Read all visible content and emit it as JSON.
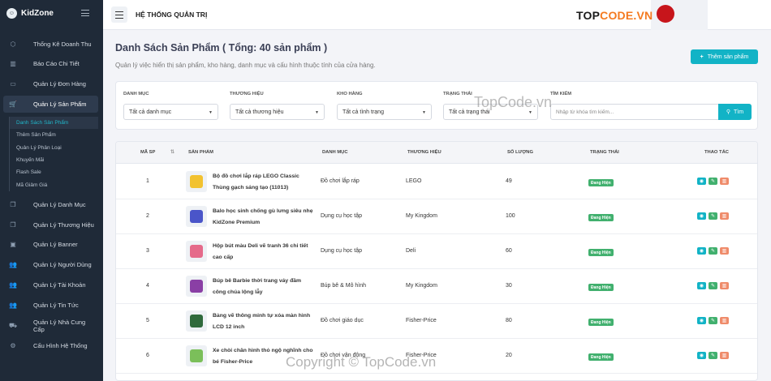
{
  "brand": {
    "name": "KidZone"
  },
  "topbar": {
    "title": "HỆ THỐNG QUẢN TRỊ"
  },
  "watermark": {
    "logo_text_a": "TOP",
    "logo_text_b": "CODE.VN",
    "center": "TopCode.vn",
    "copyright": "Copyright © TopCode.vn"
  },
  "sidebar": {
    "items": [
      {
        "label": "Thống Kê Doanh Thu",
        "icon": "cube-icon"
      },
      {
        "label": "Báo Cáo Chi Tiết",
        "icon": "chart-icon"
      },
      {
        "label": "Quản Lý Đơn Hàng",
        "icon": "card-icon"
      },
      {
        "label": "Quản Lý Sản Phẩm",
        "icon": "cart-icon"
      },
      {
        "label": "Quản Lý Danh Mục",
        "icon": "copy-icon"
      },
      {
        "label": "Quản Lý Thương Hiệu",
        "icon": "copy-icon"
      },
      {
        "label": "Quản Lý Banner",
        "icon": "image-icon"
      },
      {
        "label": "Quản Lý Người Dùng",
        "icon": "users-icon"
      },
      {
        "label": "Quản Lý Tài Khoản",
        "icon": "users-icon"
      },
      {
        "label": "Quản Lý Tin Tức",
        "icon": "users-icon"
      },
      {
        "label": "Quản Lý Nhà Cung Cấp",
        "icon": "truck-icon"
      },
      {
        "label": "Cấu Hình Hệ Thống",
        "icon": "gear-icon"
      }
    ],
    "subitems": [
      "Danh Sách Sản Phẩm",
      "Thêm Sản Phẩm",
      "Quản Lý Phân Loại",
      "Khuyến Mãi",
      "Flash Sale",
      "Mã Giảm Giá"
    ]
  },
  "page": {
    "title": "Danh Sách Sản Phẩm ( Tổng: 40 sản phẩm )",
    "subtitle": "Quản lý việc hiển thị sản phẩm, kho hàng, danh mục và cấu hình thuộc tính của cửa hàng.",
    "add_button": "Thêm sản phẩm"
  },
  "filters": {
    "category_label": "DANH MỤC",
    "category_value": "Tất cả danh mục",
    "brand_label": "THƯƠNG HIỆU",
    "brand_value": "Tất cả thương hiệu",
    "stock_label": "KHO HÀNG",
    "stock_value": "Tất cả tình trạng",
    "status_label": "TRẠNG THÁI",
    "status_value": "Tất cả trạng thái",
    "search_label": "TÌM KIẾM",
    "search_placeholder": "Nhập từ khóa tìm kiếm...",
    "search_button": "Tìm"
  },
  "table": {
    "headers": [
      "MÃ SP",
      "SẢN PHẨM",
      "DANH MỤC",
      "THƯƠNG HIỆU",
      "SỐ LƯỢNG",
      "TRẠNG THÁI",
      "THAO TÁC"
    ],
    "rows": [
      {
        "id": "1",
        "name": "Bộ đồ chơi lắp ráp LEGO Classic Thùng gạch sáng tạo (11013)",
        "category": "Đồ chơi lắp ráp",
        "brand": "LEGO",
        "qty": "49",
        "status": "Đang Hiện",
        "thumb_color": "#f2c230"
      },
      {
        "id": "2",
        "name": "Balo học sinh chống gù lưng siêu nhẹ KidZone Premium",
        "category": "Dụng cụ học tập",
        "brand": "My Kingdom",
        "qty": "100",
        "status": "Đang Hiện",
        "thumb_color": "#4a55c9"
      },
      {
        "id": "3",
        "name": "Hộp bút màu Deli vẽ tranh 36 chi tiết cao cấp",
        "category": "Dụng cụ học tập",
        "brand": "Deli",
        "qty": "60",
        "status": "Đang Hiện",
        "thumb_color": "#e56a8a"
      },
      {
        "id": "4",
        "name": "Búp bê Barbie thời trang váy đầm công chúa lộng lẫy",
        "category": "Búp bê & Mô hình",
        "brand": "My Kingdom",
        "qty": "30",
        "status": "Đang Hiện",
        "thumb_color": "#8a3fa5"
      },
      {
        "id": "5",
        "name": "Bảng vẽ thông minh tự xóa màn hình LCD 12 inch",
        "category": "Đồ chơi giáo dục",
        "brand": "Fisher-Price",
        "qty": "80",
        "status": "Đang Hiện",
        "thumb_color": "#2f6a3c"
      },
      {
        "id": "6",
        "name": "Xe chòi chân hình thỏ ngộ nghĩnh cho bé Fisher-Price",
        "category": "Đồ chơi vận động",
        "brand": "Fisher-Price",
        "qty": "20",
        "status": "Đang Hiện",
        "thumb_color": "#7bbf5a"
      }
    ]
  }
}
